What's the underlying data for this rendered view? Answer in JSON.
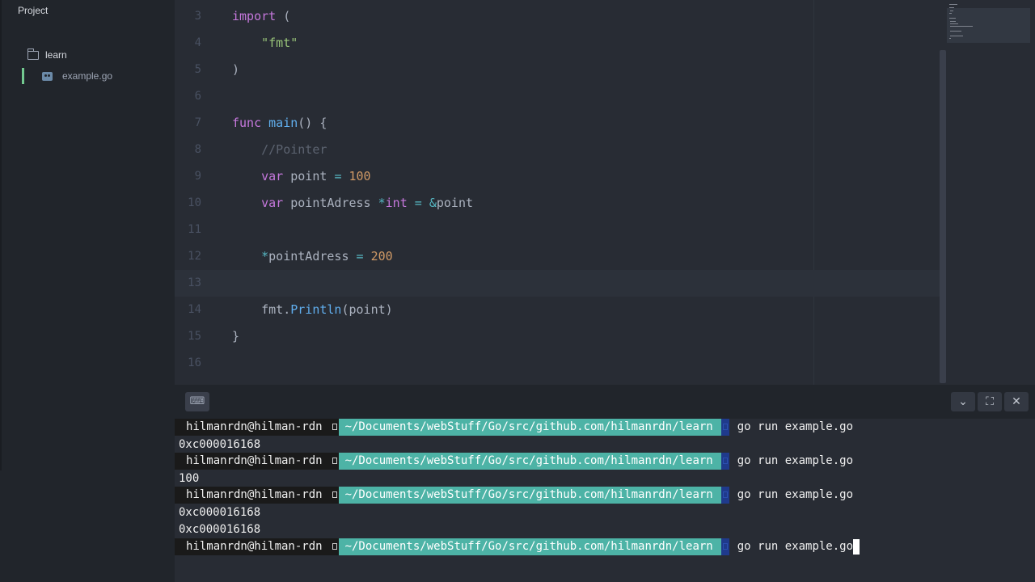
{
  "sidebar": {
    "title": "Project",
    "folder": {
      "label": "learn",
      "icon": "folder-icon"
    },
    "file": {
      "label": "example.go",
      "icon": "go-file-icon"
    }
  },
  "editor": {
    "lines": [
      {
        "num": "3",
        "tokens": [
          [
            "kw",
            "import"
          ],
          [
            "plain",
            " ("
          ]
        ]
      },
      {
        "num": "4",
        "tokens": [
          [
            "plain",
            "    "
          ],
          [
            "str",
            "\"fmt\""
          ]
        ]
      },
      {
        "num": "5",
        "tokens": [
          [
            "plain",
            ")"
          ]
        ]
      },
      {
        "num": "6",
        "tokens": []
      },
      {
        "num": "7",
        "tokens": [
          [
            "kw",
            "func"
          ],
          [
            "plain",
            " "
          ],
          [
            "fn",
            "main"
          ],
          [
            "plain",
            "() {"
          ]
        ]
      },
      {
        "num": "8",
        "tokens": [
          [
            "plain",
            "    "
          ],
          [
            "cmt",
            "//Pointer"
          ]
        ]
      },
      {
        "num": "9",
        "tokens": [
          [
            "plain",
            "    "
          ],
          [
            "kw",
            "var"
          ],
          [
            "plain",
            " point "
          ],
          [
            "op",
            "="
          ],
          [
            "plain",
            " "
          ],
          [
            "num",
            "100"
          ]
        ]
      },
      {
        "num": "10",
        "tokens": [
          [
            "plain",
            "    "
          ],
          [
            "kw",
            "var"
          ],
          [
            "plain",
            " pointAdress "
          ],
          [
            "op",
            "*"
          ],
          [
            "kw",
            "int"
          ],
          [
            "plain",
            " "
          ],
          [
            "op",
            "="
          ],
          [
            "plain",
            " "
          ],
          [
            "op",
            "&"
          ],
          [
            "plain",
            "point"
          ]
        ]
      },
      {
        "num": "11",
        "tokens": []
      },
      {
        "num": "12",
        "tokens": [
          [
            "plain",
            "    "
          ],
          [
            "op",
            "*"
          ],
          [
            "plain",
            "pointAdress "
          ],
          [
            "op",
            "="
          ],
          [
            "plain",
            " "
          ],
          [
            "num",
            "200"
          ]
        ]
      },
      {
        "num": "13",
        "tokens": [],
        "cursor": true
      },
      {
        "num": "14",
        "tokens": [
          [
            "plain",
            "    fmt."
          ],
          [
            "fn",
            "Println"
          ],
          [
            "plain",
            "(point)"
          ]
        ]
      },
      {
        "num": "15",
        "tokens": [
          [
            "plain",
            "}"
          ]
        ]
      },
      {
        "num": "16",
        "tokens": []
      }
    ]
  },
  "terminal": {
    "prompt_user": "hilmanrdn@hilman-rdn",
    "prompt_path": "~/Documents/webStuff/Go/src/github.com/hilmanrdn/learn",
    "command": "go run example.go",
    "lines": [
      {
        "type": "prompt"
      },
      {
        "type": "output",
        "text": "0xc000016168"
      },
      {
        "type": "prompt"
      },
      {
        "type": "output",
        "text": "100"
      },
      {
        "type": "prompt"
      },
      {
        "type": "output",
        "text": "0xc000016168"
      },
      {
        "type": "output",
        "text": "0xc000016168"
      },
      {
        "type": "prompt",
        "active": true
      }
    ],
    "header_buttons": {
      "keyboard": "⌨",
      "collapse": "⌄",
      "maximize": "⛶",
      "close": "✕"
    }
  }
}
